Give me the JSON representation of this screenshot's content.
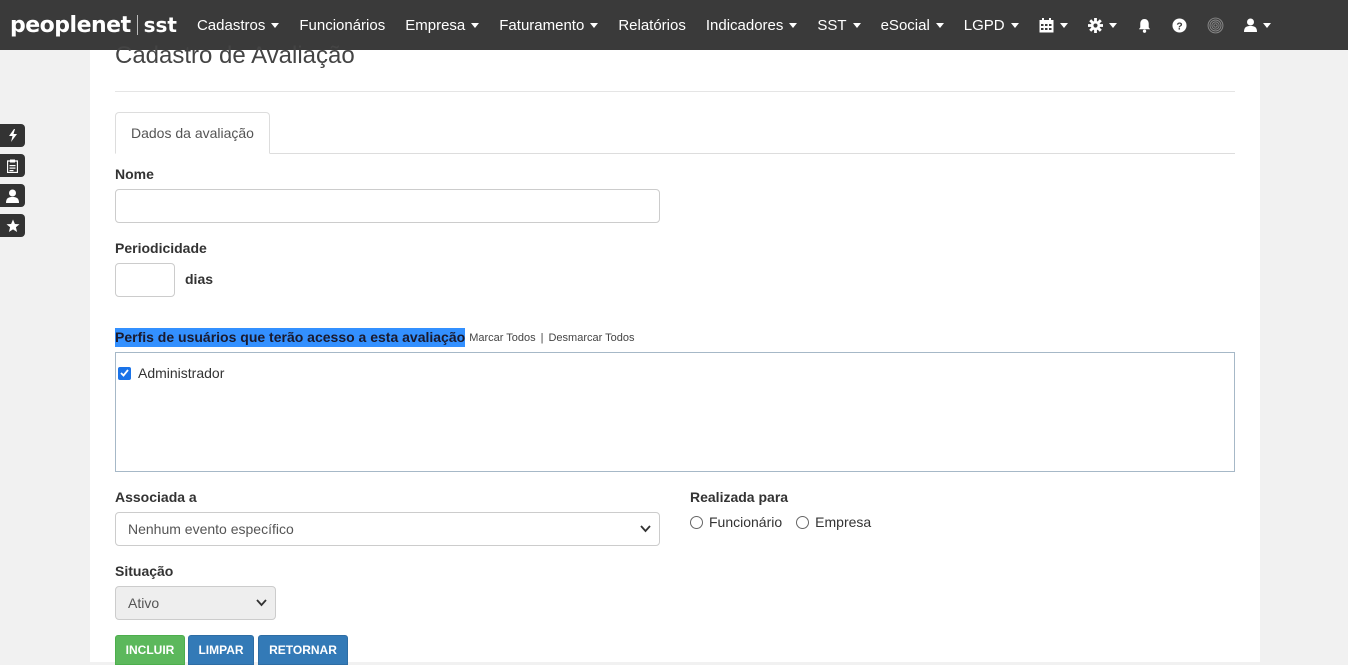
{
  "brand": {
    "name": "peoplenet",
    "product": "sst"
  },
  "nav": {
    "items": [
      {
        "label": "Cadastros",
        "dropdown": true
      },
      {
        "label": "Funcionários",
        "dropdown": false
      },
      {
        "label": "Empresa",
        "dropdown": true
      },
      {
        "label": "Faturamento",
        "dropdown": true
      },
      {
        "label": "Relatórios",
        "dropdown": false
      },
      {
        "label": "Indicadores",
        "dropdown": true
      },
      {
        "label": "SST",
        "dropdown": true
      },
      {
        "label": "eSocial",
        "dropdown": true
      },
      {
        "label": "LGPD",
        "dropdown": true
      }
    ],
    "icons": [
      "calendar-icon",
      "gear-icon",
      "bell-icon",
      "help-icon",
      "fingerprint-icon",
      "user-icon"
    ]
  },
  "sidebar": {
    "icons": [
      "bolt-icon",
      "clipboard-icon",
      "user-icon",
      "star-icon"
    ]
  },
  "page": {
    "title": "Cadastro de Avaliação"
  },
  "tabs": [
    {
      "label": "Dados da avaliação",
      "active": true
    }
  ],
  "form": {
    "nome": {
      "label": "Nome",
      "value": ""
    },
    "periodicidade": {
      "label": "Periodicidade",
      "value": "",
      "unit": "dias"
    },
    "perfis": {
      "label": "Perfis de usuários que terão acesso a esta avaliação",
      "select_all": "Marcar Todos",
      "separator": "|",
      "deselect_all": "Desmarcar Todos",
      "items": [
        {
          "label": "Administrador",
          "checked": true
        }
      ]
    },
    "associada": {
      "label": "Associada a",
      "selected": "Nenhum evento específico"
    },
    "realizada": {
      "label": "Realizada para",
      "options": [
        "Funcionário",
        "Empresa"
      ]
    },
    "situacao": {
      "label": "Situação",
      "selected": "Ativo"
    }
  },
  "buttons": {
    "incluir": "INCLUIR",
    "limpar": "LIMPAR",
    "retornar": "RETORNAR"
  },
  "colors": {
    "navbar": "#3a3a3a",
    "selection": "#3390ff",
    "success": "#5cb85c",
    "primary": "#337ab7"
  }
}
